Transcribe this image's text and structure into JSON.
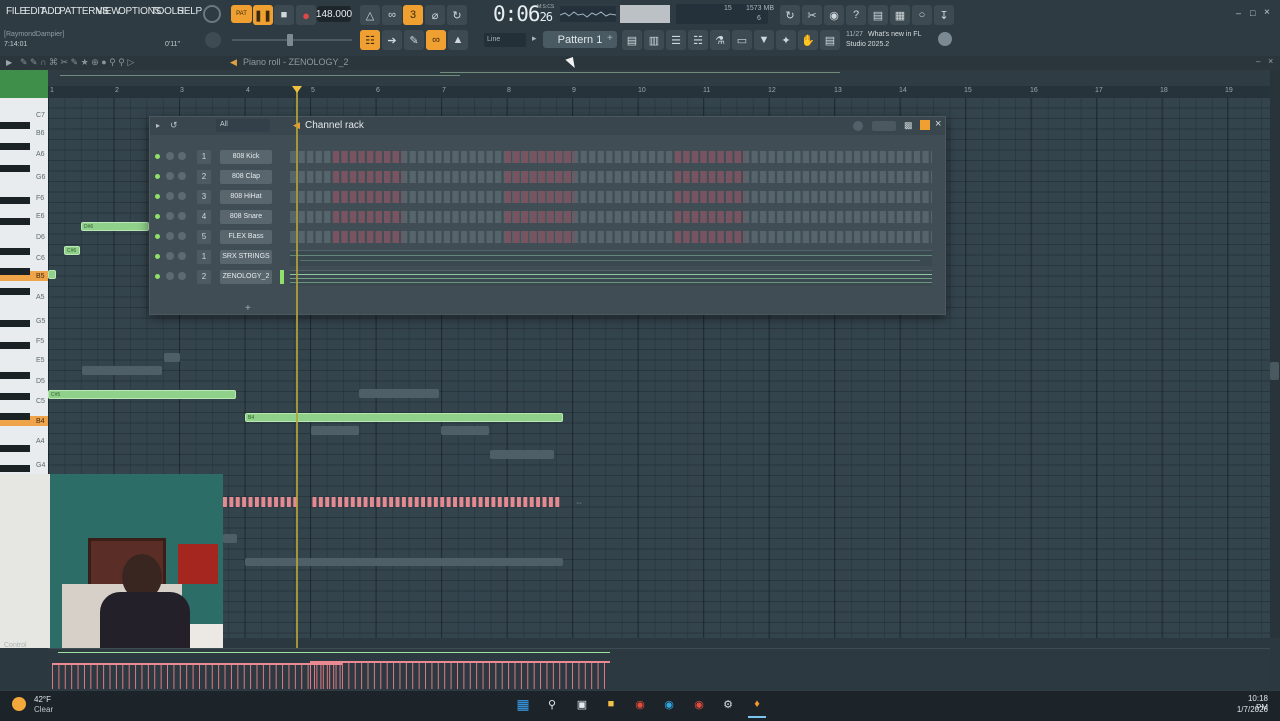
{
  "menu": [
    "FILE",
    "EDIT",
    "ADD",
    "PATTERNS",
    "VIEW",
    "OPTIONS",
    "TOOLS",
    "HELP"
  ],
  "transport": {
    "pat_label": "PAT",
    "bpm": "148.000",
    "time": "0:06",
    "time_small": "26",
    "time_label": "M:S:CS",
    "memory": "1573 MB",
    "cpu": "15",
    "voices": "6"
  },
  "pattern_name": "Pattern 1",
  "snap": "Line",
  "news": {
    "date": "11/27",
    "headline": "What's new in FL",
    "subtitle": "Studio 2025.2"
  },
  "left_info": {
    "user": "[RaymondDampier]",
    "position": "7:14:01",
    "duration": "0'11\""
  },
  "piano_roll": {
    "title": "Piano roll - ZENOLOGY_2",
    "ruler": [
      "1",
      "2",
      "3",
      "4",
      "5",
      "6",
      "7",
      "8",
      "9",
      "10",
      "11",
      "12",
      "13",
      "14",
      "15",
      "16",
      "17",
      "18",
      "19"
    ],
    "keys": [
      "C7",
      "B6",
      "A6",
      "G6",
      "F6",
      "E6",
      "D6",
      "C6",
      "B5",
      "A5",
      "G5",
      "F5",
      "E5",
      "D5",
      "C5",
      "B4",
      "A4",
      "G4"
    ],
    "note_labels": [
      "D#6",
      "C#6",
      "C#5",
      "B4"
    ]
  },
  "channel_rack": {
    "title": "Channel rack",
    "filter": "All",
    "add_label": "+",
    "channels": [
      {
        "num": "1",
        "name": "808 Kick"
      },
      {
        "num": "2",
        "name": "808 Clap"
      },
      {
        "num": "3",
        "name": "808 HiHat"
      },
      {
        "num": "4",
        "name": "808 Snare"
      },
      {
        "num": "5",
        "name": "FLEX Bass"
      },
      {
        "num": "1",
        "name": "SRX STRINGS"
      },
      {
        "num": "2",
        "name": "ZENOLOGY_2"
      }
    ]
  },
  "event_lane": {
    "label": "Control"
  },
  "taskbar": {
    "temp": "42°F",
    "weather": "Clear",
    "time": "10:18 PM",
    "date": "1/7/2026"
  },
  "colors": {
    "accent": "#f0a030",
    "note_green": "#8fd08a",
    "velocity": "#e07a86",
    "playhead": "#b6a33a"
  }
}
